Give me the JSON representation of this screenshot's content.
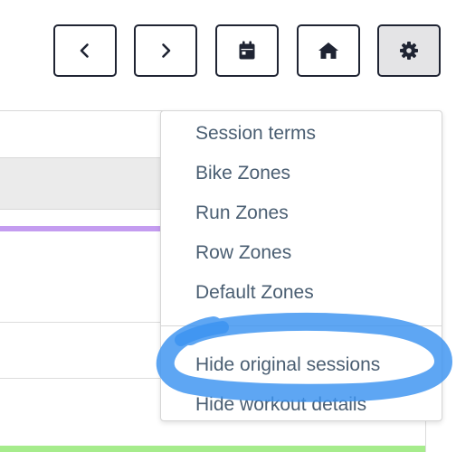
{
  "toolbar": {
    "buttons": [
      {
        "name": "previous-button",
        "icon": "chevron-left-icon"
      },
      {
        "name": "next-button",
        "icon": "chevron-right-icon"
      },
      {
        "name": "calendar-button",
        "icon": "calendar-icon"
      },
      {
        "name": "home-button",
        "icon": "home-icon"
      },
      {
        "name": "settings-button",
        "icon": "gear-icon",
        "active": true
      }
    ]
  },
  "menu": {
    "items": [
      {
        "label": "Session terms"
      },
      {
        "label": "Bike Zones"
      },
      {
        "label": "Run Zones"
      },
      {
        "label": "Row Zones"
      },
      {
        "label": "Default Zones"
      },
      {
        "label": "Hide original sessions",
        "highlighted": true
      },
      {
        "label": "Hide workout details"
      }
    ]
  },
  "colors": {
    "button_border": "#1f2433",
    "menu_text": "#4a5e72",
    "marker_blue": "#3b93f0",
    "purple_bar": "#c49cf0",
    "green_bar": "#a6ec8c",
    "header_gray": "#ebebeb"
  }
}
